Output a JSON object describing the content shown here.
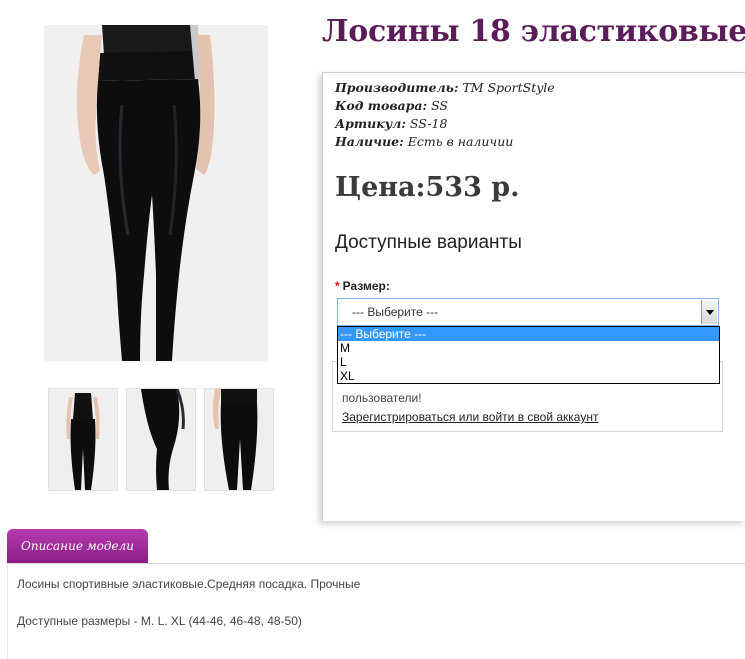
{
  "product": {
    "title": "Лосины 18 эластиковые",
    "manufacturer_label": "Производитель:",
    "manufacturer": "TM SportStyle",
    "code_label": "Код товара:",
    "code": "SS",
    "article_label": "Артикул:",
    "article": "SS-18",
    "availability_label": "Наличие:",
    "availability": "Есть в наличии",
    "price": "Цена:533 р."
  },
  "options": {
    "title": "Доступные варианты",
    "required_mark": "*",
    "size_label": "Размер:",
    "select_value": "--- Выберите ---",
    "dropdown_items": [
      "--- Выберите ---",
      "M",
      "L",
      "XL"
    ]
  },
  "login": {
    "text": "пользователи!",
    "link": "Зарегистрироваться или войти в свой аккаунт"
  },
  "tabs": {
    "description_label": "Описание модели"
  },
  "description": {
    "line1": "Лосины спортивные эластиковые.Средняя посадка. Прочные",
    "line2": "Доступные размеры - M. L. XL (44-46, 46-48, 48-50)"
  },
  "icons": {
    "dropdown_arrow": "chevron-down-icon"
  },
  "colors": {
    "title": "#5b1d5a",
    "tab": "#a02d9c",
    "selected_option": "#3399ff"
  }
}
